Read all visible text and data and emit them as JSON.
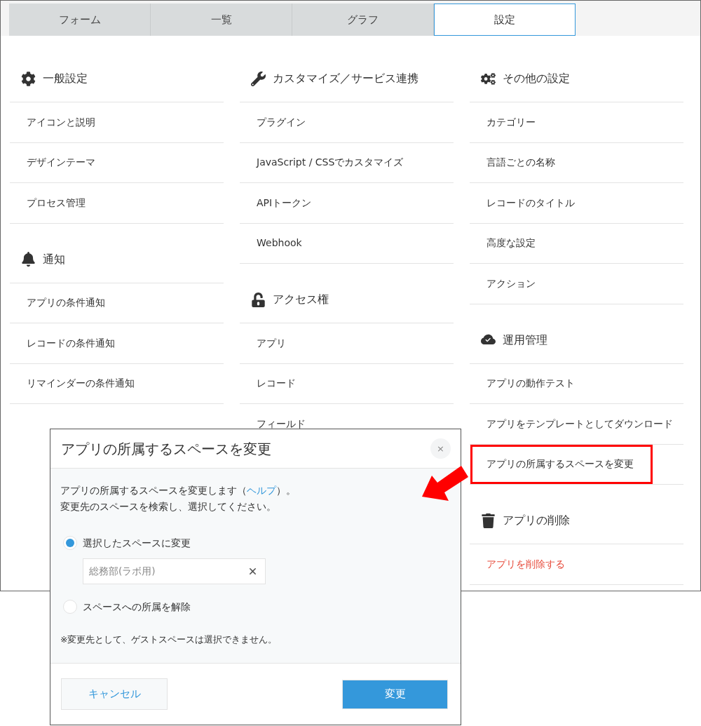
{
  "tabs": [
    {
      "label": "フォーム",
      "selected": false
    },
    {
      "label": "一覧",
      "selected": false
    },
    {
      "label": "グラフ",
      "selected": false
    },
    {
      "label": "設定",
      "selected": true
    }
  ],
  "columns": [
    {
      "sections": [
        {
          "title": "一般設定",
          "items": [
            {
              "label": "アイコンと説明",
              "kind": "link",
              "highlighted": false
            },
            {
              "label": "デザインテーマ",
              "kind": "link",
              "highlighted": false
            },
            {
              "label": "プロセス管理",
              "kind": "link",
              "highlighted": false
            }
          ]
        },
        {
          "title": "通知",
          "items": [
            {
              "label": "アプリの条件通知",
              "kind": "link",
              "highlighted": false
            },
            {
              "label": "レコードの条件通知",
              "kind": "link",
              "highlighted": false
            },
            {
              "label": "リマインダーの条件通知",
              "kind": "link",
              "highlighted": false
            }
          ]
        }
      ]
    },
    {
      "sections": [
        {
          "title": "カスタマイズ／サービス連携",
          "items": [
            {
              "label": "プラグイン",
              "kind": "link",
              "highlighted": false
            },
            {
              "label": "JavaScript / CSSでカスタマイズ",
              "kind": "link",
              "highlighted": false
            },
            {
              "label": "APIトークン",
              "kind": "link",
              "highlighted": false
            },
            {
              "label": "Webhook",
              "kind": "link",
              "highlighted": false
            }
          ]
        },
        {
          "title": "アクセス権",
          "items": [
            {
              "label": "アプリ",
              "kind": "link",
              "highlighted": false
            },
            {
              "label": "レコード",
              "kind": "link",
              "highlighted": false
            },
            {
              "label": "フィールド",
              "kind": "link",
              "highlighted": false
            }
          ]
        }
      ]
    },
    {
      "sections": [
        {
          "title": "その他の設定",
          "items": [
            {
              "label": "カテゴリー",
              "kind": "link",
              "highlighted": false
            },
            {
              "label": "言語ごとの名称",
              "kind": "link",
              "highlighted": false
            },
            {
              "label": "レコードのタイトル",
              "kind": "link",
              "highlighted": false
            },
            {
              "label": "高度な設定",
              "kind": "link",
              "highlighted": false
            },
            {
              "label": "アクション",
              "kind": "link",
              "highlighted": false
            }
          ]
        },
        {
          "title": "運用管理",
          "items": [
            {
              "label": "アプリの動作テスト",
              "kind": "link",
              "highlighted": false
            },
            {
              "label": "アプリをテンプレートとしてダウンロード",
              "kind": "link",
              "highlighted": false
            },
            {
              "label": "アプリの所属するスペースを変更",
              "kind": "link",
              "highlighted": true
            }
          ]
        },
        {
          "title": "アプリの削除",
          "items": [
            {
              "label": "アプリを削除する",
              "kind": "danger",
              "highlighted": false
            }
          ]
        }
      ]
    }
  ],
  "dialog": {
    "title": "アプリの所属するスペースを変更",
    "close": "×",
    "description": {
      "before": "アプリの所属するスペースを変更します（",
      "link": "ヘルプ",
      "after": "）。"
    },
    "instruction": "変更先のスペースを検索し、選択してください。",
    "options": [
      {
        "label": "選択したスペースに変更",
        "selected": true
      },
      {
        "label": "スペースへの所属を解除",
        "selected": false
      }
    ],
    "space_field": {
      "value": "総務部(ラボ用)"
    },
    "note": "※変更先として、ゲストスペースは選択できません。",
    "buttons": {
      "cancel": "キャンセル",
      "submit": "変更"
    }
  }
}
